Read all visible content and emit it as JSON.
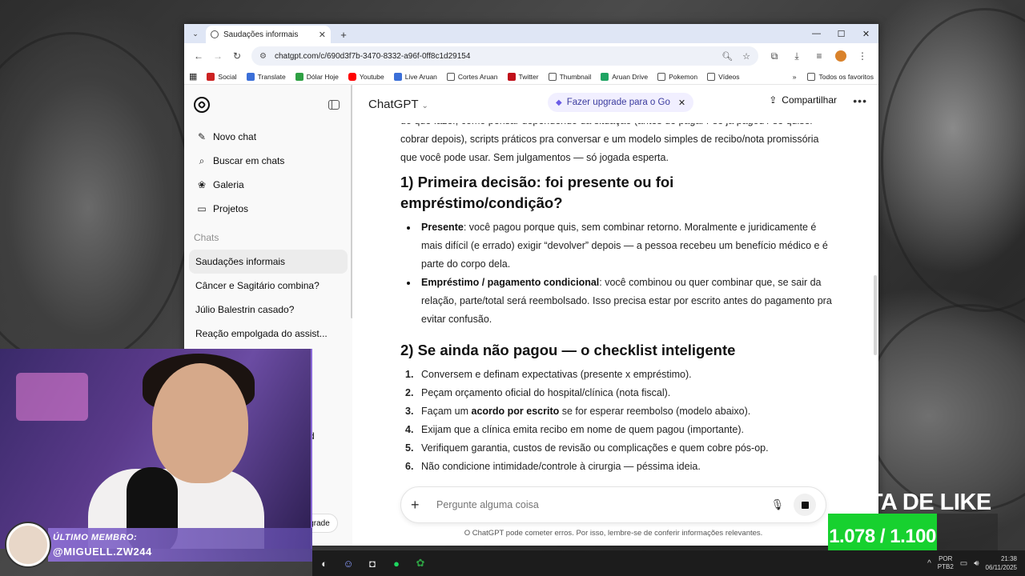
{
  "browser": {
    "tab_title": "Saudações informais",
    "url": "chatgpt.com/c/690d3f7b-3470-8332-a96f-0ff8c1d29154",
    "bookmarks": [
      {
        "label": "Social",
        "color": "#cc2222"
      },
      {
        "label": "Translate",
        "color": "#3b6fd8"
      },
      {
        "label": "Dólar Hoje",
        "color": "#2ea043"
      },
      {
        "label": "Youtube",
        "color": "#ff0000"
      },
      {
        "label": "Live Aruan",
        "color": "#3b6fd8"
      },
      {
        "label": "Cortes Aruan",
        "color": "#555555"
      },
      {
        "label": "Twitter",
        "color": "#c0101a"
      },
      {
        "label": "Thumbnail",
        "color": "#555555"
      },
      {
        "label": "Aruan Drive",
        "color": "#1fa463"
      },
      {
        "label": "Pokemon",
        "color": "#555555"
      },
      {
        "label": "Vídeos",
        "color": "#555555"
      }
    ],
    "all_bookmarks": "Todos os favoritos"
  },
  "sidebar": {
    "nav": [
      {
        "label": "Novo chat",
        "icon": "edit-icon"
      },
      {
        "label": "Buscar em chats",
        "icon": "search-icon"
      },
      {
        "label": "Galeria",
        "icon": "gallery-icon"
      },
      {
        "label": "Projetos",
        "icon": "folder-icon"
      }
    ],
    "section_label": "Chats",
    "chats": [
      "Saudações informais",
      "Câncer e Sagitário combina?",
      "Júlio Balestrin casado?",
      "Reação empolgada do assist..."
    ],
    "upgrade_partial": "grade",
    "hidden_partial": "d"
  },
  "header": {
    "model": "ChatGPT",
    "promo": "Fazer upgrade para o Go",
    "share": "Compartilhar"
  },
  "content": {
    "intro": "do que fazer, como pensar dependendo da situação (antes de pagar / se já pagou / se quiser cobrar depois), scripts práticos pra conversar e um modelo simples de recibo/nota promissória que você pode usar. Sem julgamentos — só jogada esperta.",
    "h1": "1) Primeira decisão: foi presente ou foi empréstimo/condição?",
    "bullets": [
      {
        "bold": "Presente",
        "text": ": você pagou porque quis, sem combinar retorno. Moralmente e juridicamente é mais difícil (e errado) exigir “devolver” depois — a pessoa recebeu um benefício médico e é parte do corpo dela."
      },
      {
        "bold": "Empréstimo / pagamento condicional",
        "text": ": você combinou ou quer combinar que, se sair da relação, parte/total será reembolsado. Isso precisa estar por escrito antes do pagamento pra evitar confusão."
      }
    ],
    "h2": "2) Se ainda não pagou — o checklist inteligente",
    "steps": [
      {
        "n": "1.",
        "pre": "Conversem e definam expectativas (presente x empréstimo).",
        "bold": "",
        "post": ""
      },
      {
        "n": "2.",
        "pre": "Peçam orçamento oficial do hospital/clínica (nota fiscal).",
        "bold": "",
        "post": ""
      },
      {
        "n": "3.",
        "pre": "Façam um ",
        "bold": "acordo por escrito",
        "post": " se for esperar reembolso (modelo abaixo)."
      },
      {
        "n": "4.",
        "pre": "Exijam que a clínica emita recibo em nome de quem pagou (importante).",
        "bold": "",
        "post": ""
      },
      {
        "n": "5.",
        "pre": "Verifiquem garantia, custos de revisão ou complicações e quem cobre pós-op.",
        "bold": "",
        "post": ""
      },
      {
        "n": "6.",
        "pre": "Não condicione intimidade/controle à cirurgia — péssima ideia.",
        "bold": "",
        "post": ""
      }
    ]
  },
  "composer": {
    "placeholder": "Pergunte alguma coisa",
    "disclaimer": "O ChatGPT pode cometer erros. Por isso, lembre-se de conferir informações relevantes."
  },
  "stream": {
    "member_title": "ÚLTIMO MEMBRO:",
    "member_name": "@MIGUELL.ZW244",
    "like_title": "ETA DE LIKE",
    "like_count": "1.078 / 1.100",
    "like_progress": 0.98
  },
  "taskbar": {
    "lang_top": "POR",
    "lang_bottom": "PTB2",
    "time": "21:38",
    "date": "06/11/2025"
  }
}
